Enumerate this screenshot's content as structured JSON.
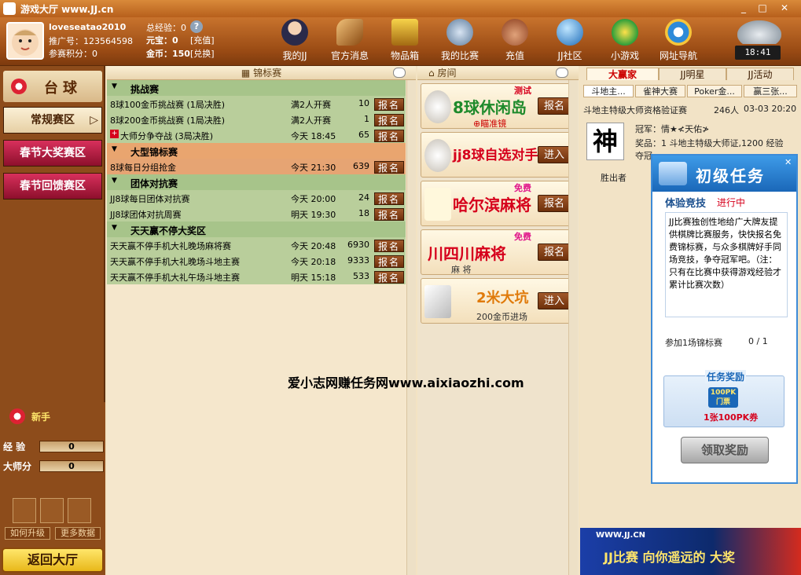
{
  "titlebar": {
    "title": "游戏大厅  www.JJ.cn"
  },
  "user": {
    "name": "loveseatao2010",
    "promo_label": "推广号：123564598",
    "points_label": "参赛积分：0",
    "exp_label": "总经验：0",
    "yuanbao_label": "元宝：0",
    "recharge_link": "[充值]",
    "gold_label": "金币：150",
    "exchange_link": "[兑换]"
  },
  "nav": [
    {
      "label": "我的JJ",
      "icon": "my-jj-icon"
    },
    {
      "label": "官方消息",
      "icon": "horn-icon"
    },
    {
      "label": "物品箱",
      "icon": "treasure-box-icon"
    },
    {
      "label": "我的比赛",
      "icon": "crossed-swords-icon"
    },
    {
      "label": "充值",
      "icon": "money-bag-icon"
    },
    {
      "label": "JJ社区",
      "icon": "globe-icon"
    },
    {
      "label": "小游戏",
      "icon": "mini-game-icon"
    },
    {
      "label": "网址导航",
      "icon": "ie-icon"
    }
  ],
  "clock": "18:41",
  "left": {
    "game_title": "台球",
    "tabs": [
      "常规赛区",
      "春节大奖赛区",
      "春节回馈赛区"
    ],
    "newbie_label": "新手",
    "exp_label": "经  验",
    "exp_value": "0",
    "master_label": "大师分",
    "master_value": "0",
    "how_upgrade": "如何升级",
    "more_data": "更多数据",
    "return_button": "返回大厅"
  },
  "center": {
    "header": "锦标赛",
    "sign_label": "报名",
    "categories": [
      {
        "name": "挑战赛",
        "rows": [
          {
            "name": "8球100金币挑战赛 (1局决胜)",
            "time": "满2人开赛",
            "count": "10"
          },
          {
            "name": "8球200金币挑战赛 (1局决胜)",
            "time": "满2人开赛",
            "count": "1"
          },
          {
            "name": "大师分争夺战 (3局决胜)",
            "time": "今天  18:45",
            "count": "65"
          }
        ]
      },
      {
        "name": "大型锦标赛",
        "rows": [
          {
            "name": "8球每日分组抢金",
            "time": "今天  21:30",
            "count": "639"
          }
        ]
      },
      {
        "name": "团体对抗赛",
        "rows": [
          {
            "name": "JJ8球每日团体对抗赛",
            "time": "今天  20:00",
            "count": "24"
          },
          {
            "name": "JJ8球团体对抗周赛",
            "time": "明天  19:30",
            "count": "18"
          }
        ]
      },
      {
        "name": "天天赢不停大奖区",
        "rows": [
          {
            "name": "天天赢不停手机大礼晚场麻将赛",
            "time": "今天  20:48",
            "count": "6930"
          },
          {
            "name": "天天赢不停手机大礼晚场斗地主赛",
            "time": "今天  20:18",
            "count": "9333"
          },
          {
            "name": "天天赢不停手机大礼午场斗地主赛",
            "time": "明天  15:18",
            "count": "533"
          }
        ]
      }
    ]
  },
  "rooms": {
    "header": "房间",
    "cards": [
      {
        "title": "8球休闲岛",
        "tag": "测试",
        "sub": "⊕瞄准镜",
        "button": "报名"
      },
      {
        "title": "jj8球自选对手",
        "tag": "",
        "sub": "",
        "button": "进入"
      },
      {
        "title": "哈尔滨麻将",
        "tag": "免费",
        "sub": "",
        "button": "报名"
      },
      {
        "title": "川四川麻将",
        "tag": "免费",
        "sub": "麻 将",
        "button": "报名"
      },
      {
        "title": "2米大坑",
        "tag": "",
        "sub": "200金币进场",
        "button": "进入"
      }
    ]
  },
  "right": {
    "tabs": [
      "大赢家",
      "JJ明星",
      "JJ活动"
    ],
    "subtabs": [
      "斗地主...",
      "雀神大赛",
      "Poker金...",
      "赢三张..."
    ],
    "event_title": "斗地主特级大师资格验证赛",
    "event_count": "246人",
    "event_time": "03-03 20:20",
    "champion_label": "冠军：情★≮天佑≯",
    "prize_label": "奖品：1 斗地主特级大师证,1200 经验",
    "prize_extra": "夺冠...",
    "winner_col": "胜出者",
    "seal_char": "神"
  },
  "quest": {
    "title": "初级任务",
    "subtitle": "体验竞技",
    "status": "进行中",
    "description": "JJ比赛独创性地给广大牌友提供棋牌比赛服务，快快报名免费锦标赛，与众多棋牌好手同场竞技，争夺冠军吧。（注：只有在比赛中获得游戏经验才累计比赛次数）",
    "progress_label": "参加1场锦标赛",
    "progress_value": "0  /  1",
    "reward_title": "任务奖励",
    "reward_ticket": "100PK门票",
    "reward_text": "1张100PK券",
    "claim_button": "领取奖励"
  },
  "banner": {
    "site": "WWW.JJ.CN",
    "text": "JJ比赛 向你遥远的 大奖"
  },
  "watermark": "爱小志网赚任务网www.aixiaozhi.com"
}
